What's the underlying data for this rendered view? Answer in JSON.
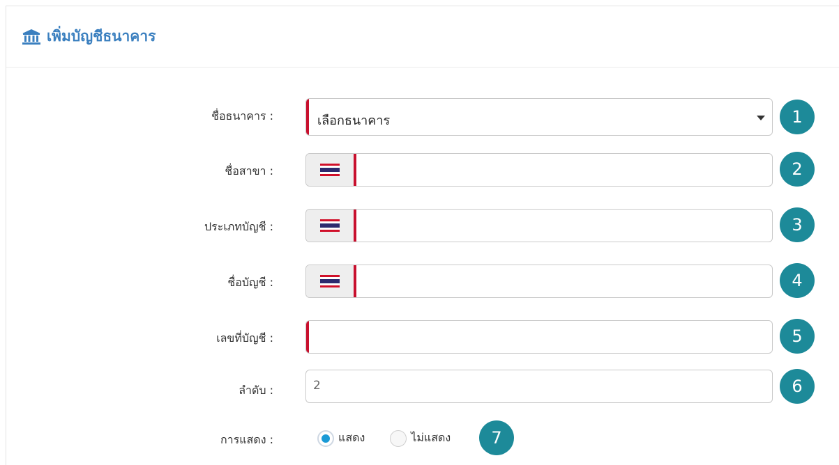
{
  "header": {
    "title": "เพิ่มบัญชีธนาคาร",
    "icon": "bank-icon",
    "title_color": "#3a7fbf"
  },
  "form": {
    "bank_name": {
      "label": "ชื่อธนาคาร :",
      "selected": "เลือกธนาคาร",
      "badge": "1"
    },
    "branch_name": {
      "label": "ชื่อสาขา :",
      "value": "",
      "badge": "2",
      "addon_icon": "thai-flag-icon"
    },
    "account_type": {
      "label": "ประเภทบัญชี :",
      "value": "",
      "badge": "3",
      "addon_icon": "thai-flag-icon"
    },
    "account_name": {
      "label": "ชื่อบัญชี :",
      "value": "",
      "badge": "4",
      "addon_icon": "thai-flag-icon"
    },
    "account_number": {
      "label": "เลขที่บัญชี :",
      "value": "",
      "badge": "5"
    },
    "order": {
      "label": "ลำดับ :",
      "value": "2",
      "badge": "6"
    },
    "display": {
      "label": "การแสดง :",
      "options": [
        {
          "label": "แสดง",
          "checked": true
        },
        {
          "label": "ไม่แสดง",
          "checked": false
        }
      ],
      "badge": "7"
    }
  },
  "colors": {
    "required_marker": "#c8102e",
    "badge": "#1d8a99",
    "radio_checked": "#1a9ad6"
  }
}
